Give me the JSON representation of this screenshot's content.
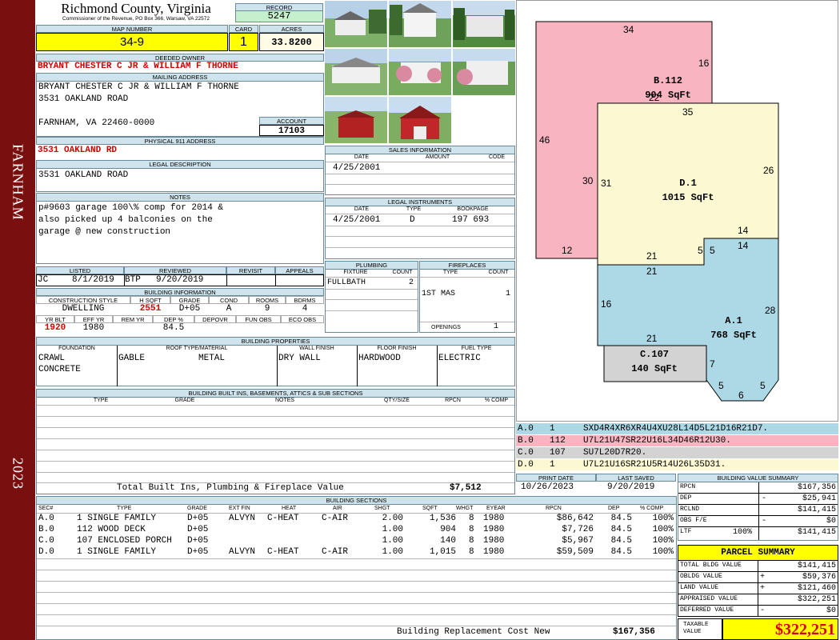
{
  "county": "Richmond County, Virginia",
  "commissioner": "Commissioner of the Revenue, PO Box 366, Warsaw, VA 22572",
  "side_left": "FARNHAM",
  "side_year": "2023",
  "record": {
    "label": "RECORD",
    "value": "5247"
  },
  "map_number": {
    "label": "MAP NUMBER",
    "value": "34-9"
  },
  "card": {
    "label": "CARD",
    "value": "1"
  },
  "acres": {
    "label": "ACRES",
    "value": "33.8200"
  },
  "deeded_owner": {
    "label": "DEEDED OWNER",
    "value": "BRYANT CHESTER C JR & WILLIAM F THORNE"
  },
  "mailing": {
    "label": "MAILING ADDRESS",
    "line1": "BRYANT CHESTER C JR & WILLIAM F THORNE",
    "line2": "3531 OAKLAND ROAD",
    "line3": "FARNHAM, VA 22460-0000"
  },
  "account": {
    "label": "ACCOUNT",
    "value": "17103"
  },
  "physical": {
    "label": "PHYSICAL 911 ADDRESS",
    "value": "3531 OAKLAND RD"
  },
  "legal": {
    "label": "LEGAL DESCRIPTION",
    "value": "3531 OAKLAND ROAD"
  },
  "notes": {
    "label": "NOTES",
    "line1": "p#9603 garage 100\\% comp for 2014 &",
    "line2": "also picked up 4 balconies on the",
    "line3": "garage @ new construction"
  },
  "listed": {
    "label": "LISTED",
    "by": "JC",
    "date": "8/1/2019"
  },
  "reviewed": {
    "label": "REVIEWED",
    "by": "BTP",
    "date": "9/20/2019"
  },
  "revisit": {
    "label": "REVISIT"
  },
  "appeals": {
    "label": "APPEALS"
  },
  "building_info": {
    "label": "BUILDING INFORMATION",
    "h_style": "CONSTRUCTION STYLE",
    "style": "DWELLING",
    "h_hsqft": "H SQFT",
    "hsqft": "2551",
    "h_grade": "GRADE",
    "grade": "D+05",
    "h_cond": "COND",
    "cond": "A",
    "h_rooms": "ROOMS",
    "rooms": "9",
    "h_bdrms": "BDRMS",
    "bdrms": "4",
    "h_yrblt": "YR BLT",
    "yrblt": "1920",
    "h_effyr": "EFF YR",
    "effyr": "1980",
    "h_remyr": "REM YR",
    "h_dep": "DEP %",
    "dep": "84.5",
    "h_depovr": "DEPOVR",
    "h_funobs": "FUN OBS",
    "h_ecoobs": "ECO OBS"
  },
  "sales": {
    "label": "SALES INFORMATION",
    "h_date": "DATE",
    "h_amount": "AMOUNT",
    "h_code": "CODE",
    "date": "4/25/2001"
  },
  "legal_instr": {
    "label": "LEGAL INSTRUMENTS",
    "h_date": "DATE",
    "h_type": "TYPE",
    "h_book": "BOOKPAGE",
    "date": "4/25/2001",
    "type": "D",
    "book": "197 693"
  },
  "plumbing": {
    "label": "PLUMBING",
    "h_fixture": "FIXTURE",
    "h_count": "COUNT",
    "fixture": "FULLBATH",
    "count": "2"
  },
  "fireplaces": {
    "label": "FIREPLACES",
    "h_type": "TYPE",
    "h_count": "COUNT",
    "type": "1ST MAS",
    "count": "1",
    "openings_label": "OPENINGS",
    "openings": "1"
  },
  "properties": {
    "label": "BUILDING PROPERTIES",
    "h_foundation": "FOUNDATION",
    "foundation1": "CRAWL",
    "foundation2": "CONCRETE",
    "h_roof": "ROOF TYPE/MATERIAL",
    "roof_type": "GABLE",
    "roof_mat": "METAL",
    "h_wall": "WALL FINISH",
    "wall": "DRY WALL",
    "h_floor": "FLOOR FINISH",
    "floor": "HARDWOOD",
    "h_fuel": "FUEL TYPE",
    "fuel": "ELECTRIC"
  },
  "builtins": {
    "label": "BUILDING BUILT INS, BASEMENTS, ATTICS & SUB SECTIONS",
    "h_type": "TYPE",
    "h_grade": "GRADE",
    "h_notes": "NOTES",
    "h_qty": "QTY/SIZE",
    "h_rpcn": "RPCN",
    "h_comp": "% COMP",
    "total_label": "Total Built Ins, Plumbing & Fireplace Value",
    "total": "$7,512"
  },
  "print_date": {
    "label": "PRINT DATE",
    "value": "10/26/2023"
  },
  "last_saved": {
    "label": "LAST SAVED",
    "value": "9/20/2019"
  },
  "sections": {
    "label": "BUILDING SECTIONS",
    "headers": [
      "SEC#",
      "TYPE",
      "GRADE",
      "EXT FIN",
      "HEAT",
      "AIR",
      "SHGT",
      "SQFT",
      "WHGT",
      "EYEAR",
      "RPCN",
      "DEP",
      "% COMP"
    ],
    "rows": [
      {
        "sec": "A.0",
        "type": "1 SINGLE FAMILY",
        "grade": "D+05",
        "ext": "ALVYN",
        "heat": "C-HEAT",
        "air": "C-AIR",
        "shgt": "2.00",
        "sqft": "1,536",
        "whgt": "8",
        "eyear": "1980",
        "rpcn": "$86,642",
        "dep": "84.5",
        "comp": "100%"
      },
      {
        "sec": "B.0",
        "type": "112 WOOD DECK",
        "grade": "D+05",
        "ext": "",
        "heat": "",
        "air": "",
        "shgt": "1.00",
        "sqft": "904",
        "whgt": "8",
        "eyear": "1980",
        "rpcn": "$7,726",
        "dep": "84.5",
        "comp": "100%"
      },
      {
        "sec": "C.0",
        "type": "107 ENCLOSED PORCH",
        "grade": "D+05",
        "ext": "",
        "heat": "",
        "air": "",
        "shgt": "1.00",
        "sqft": "140",
        "whgt": "8",
        "eyear": "1980",
        "rpcn": "$5,967",
        "dep": "84.5",
        "comp": "100%"
      },
      {
        "sec": "D.0",
        "type": "1 SINGLE FAMILY",
        "grade": "D+05",
        "ext": "ALVYN",
        "heat": "C-HEAT",
        "air": "C-AIR",
        "shgt": "1.00",
        "sqft": "1,015",
        "whgt": "8",
        "eyear": "1980",
        "rpcn": "$59,509",
        "dep": "84.5",
        "comp": "100%"
      }
    ],
    "brcn_label": "Building Replacement Cost New",
    "brcn": "$167,356"
  },
  "sketch": {
    "sections": [
      {
        "id": "B.112",
        "area": "904 SqFt",
        "color": "#f8b4c0"
      },
      {
        "id": "D.1",
        "area": "1015 SqFt",
        "color": "#fbf8d2"
      },
      {
        "id": "A.1",
        "area": "768 SqFt",
        "color": "#add8e6"
      },
      {
        "id": "C.107",
        "area": "140 SqFt",
        "color": "#d3d3d3"
      }
    ],
    "dims": [
      "34",
      "16",
      "46",
      "30",
      "12",
      "22",
      "35",
      "31",
      "26",
      "14",
      "14",
      "5",
      "5",
      "21",
      "21",
      "16",
      "28",
      "21",
      "7",
      "5",
      "6",
      "5"
    ],
    "legend": [
      {
        "sec": "A.0",
        "num": "1",
        "code": "SXD4R4XR6XR4U4XU28L14D5L21D16R21D7.",
        "color": "#add8e6"
      },
      {
        "sec": "B.0",
        "num": "112",
        "code": "U7L21U47SR22U16L34D46R12U30.",
        "color": "#f8b4c0"
      },
      {
        "sec": "C.0",
        "num": "107",
        "code": "SU7L20D7R20.",
        "color": "#d3d3d3"
      },
      {
        "sec": "D.0",
        "num": "1",
        "code": "U7L21U16SR21U5R14U26L35D31.",
        "color": "#fbf8d2"
      }
    ]
  },
  "bvs": {
    "label": "BUILDING VALUE SUMMARY",
    "rows": [
      {
        "k": "RPCN",
        "s": "",
        "v": "$167,356"
      },
      {
        "k": "DEP",
        "s": "-",
        "v": "$25,941"
      },
      {
        "k": "RCLND",
        "s": "",
        "v": "$141,415"
      },
      {
        "k": "OBS F/E",
        "s": "-",
        "v": "$0"
      },
      {
        "k": "LTF",
        "pct": "100%",
        "s": "",
        "v": "$141,415"
      }
    ]
  },
  "parcel": {
    "label": "PARCEL SUMMARY",
    "rows": [
      {
        "k": "TOTAL BLDG VALUE",
        "s": "",
        "v": "$141,415"
      },
      {
        "k": "OBLDG VALUE",
        "s": "+",
        "v": "$59,376"
      },
      {
        "k": "LAND VALUE",
        "s": "+",
        "v": "$121,460"
      },
      {
        "k": "APPRAISED VALUE",
        "s": "",
        "v": "$322,251"
      },
      {
        "k": "DEFERRED VALUE",
        "s": "-",
        "v": "$0"
      }
    ],
    "taxable_label1": "TAXABLE",
    "taxable_label2": "VALUE",
    "taxable": "$322,251"
  },
  "colors": {
    "sidebar": "#7a0f0f",
    "header_fill": "#cfe3ec",
    "yellow": "#ffff00",
    "record_green": "#c6efce",
    "red_text": "#d00000"
  }
}
